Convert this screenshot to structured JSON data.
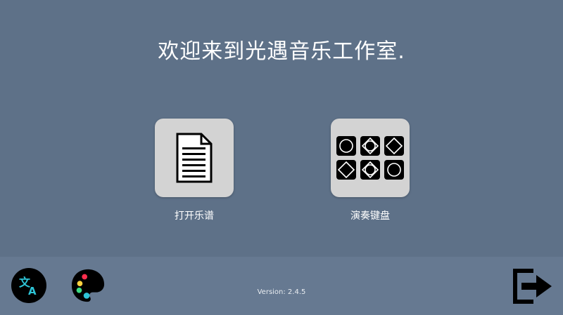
{
  "app": {
    "title": "欢迎来到光遇音乐工作室."
  },
  "menu": {
    "open_score": {
      "label": "打开乐谱",
      "icon": "document-icon"
    },
    "play_keyboard": {
      "label": "演奏键盘",
      "icon": "keyboard-grid-icon"
    }
  },
  "footer": {
    "version": "Version: 2.4.5",
    "language_icon": "translate-icon",
    "theme_icon": "palette-icon",
    "exit_icon": "exit-icon"
  },
  "colors": {
    "background": "#5e7188",
    "footer": "#667991",
    "tile": "#d3d3d3",
    "translate_accent": "#2ec4d6"
  }
}
